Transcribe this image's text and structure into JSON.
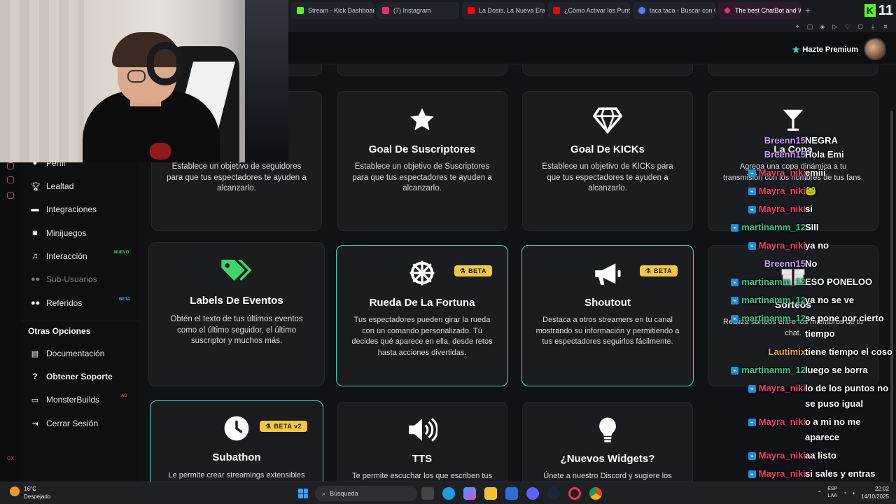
{
  "browser": {
    "tabs": [
      {
        "label": "Stream - Kick Dashboard",
        "color": "#53fc18"
      },
      {
        "label": "(7) Instagram",
        "color": "#e1306c"
      },
      {
        "label": "La Dosis, La Nueva Era",
        "color": "#ff0000"
      },
      {
        "label": "¿Cómo Activar los Puntos",
        "color": "#ff0000"
      },
      {
        "label": "taca taca - Buscar con Google",
        "color": "#4285f4"
      },
      {
        "label": "The best ChatBot and Widgets",
        "color": "#d9366b"
      }
    ],
    "new_tab": "+",
    "brand_number": "11"
  },
  "header": {
    "premium_label": "Hazte Premium"
  },
  "sidebar": {
    "items": [
      {
        "label": "Perfil",
        "icon": "user-icon"
      },
      {
        "label": "Lealtad",
        "icon": "trophy-icon"
      },
      {
        "label": "Integraciones",
        "icon": "screen-icon"
      },
      {
        "label": "Minijuegos",
        "icon": "gamepad-icon"
      },
      {
        "label": "Interacción",
        "icon": "music-icon",
        "badge": "NUEVO"
      },
      {
        "label": "Sub-Usuarios",
        "icon": "users-icon"
      },
      {
        "label": "Referidos",
        "icon": "users-icon",
        "badge": "BETA"
      }
    ],
    "section_title": "Otras Opciones",
    "other_items": [
      {
        "label": "Documentación",
        "icon": "document-icon"
      },
      {
        "label": "Obtener Soporte",
        "icon": "help-icon"
      },
      {
        "label": "MonsterBuilds",
        "icon": "laptop-icon",
        "badge": "AD"
      },
      {
        "label": "Cerrar Sesión",
        "icon": "logout-icon"
      }
    ],
    "footer": "GX"
  },
  "cards": [
    {
      "title": "",
      "desc": "Establece un objetivo de seguidores para que tus espectadores te ayuden a alcanzarlo.",
      "icon": "users-icon"
    },
    {
      "title": "Goal De Suscriptores",
      "desc": "Establece un objetivo de Suscriptores para que tus espectadores te ayuden a alcanzarlo.",
      "icon": "star-icon"
    },
    {
      "title": "Goal De KICKs",
      "desc": "Establece un objetivo de KICKs para que tus espectadores te ayuden a alcanzarlo.",
      "icon": "diamond-icon"
    },
    {
      "title": "La Copa",
      "desc": "Agrega una copa dinámica a tu transmisión con los nombres de tus fans.",
      "icon": "cocktail-icon"
    },
    {
      "title": "Labels De Eventos",
      "desc": "Obtén el texto de tus últimos eventos como el último seguidor, el último suscriptor y muchos más.",
      "icon": "tags-icon"
    },
    {
      "title": "Rueda De La Fortuna",
      "desc": "Tus espectadores pueden girar la rueda con un comando personalizado. Tú decides qué aparece en ella, desde retos hasta acciones divertidas.",
      "icon": "wheel-icon",
      "badge": "BETA"
    },
    {
      "title": "Shoutout",
      "desc": "Destaca a otros streamers en tu canal mostrando su información y permitiendo a tus espectadores seguirlos fácilmente.",
      "icon": "megaphone-icon",
      "badge": "BETA"
    },
    {
      "title": "Sorteos",
      "desc": "Realiza sorteos entre los miembros de tu chat.",
      "icon": "gift-icon"
    },
    {
      "title": "Subathon",
      "desc": "Le permite crear streamings extensibles",
      "icon": "clock-icon",
      "badge": "BETA v2"
    },
    {
      "title": "TTS",
      "desc": "Te permite escuchar los que escriben tus",
      "icon": "speaker-icon"
    },
    {
      "title": "¿Nuevos Widgets?",
      "desc": "Únete a nuestro Discord y sugiere los",
      "icon": "lightbulb-icon"
    }
  ],
  "chat": [
    {
      "user": "Breenn15",
      "text": "NEGRA",
      "color": "#c89bff",
      "tw": false
    },
    {
      "user": "Breenn15",
      "text": "Hola Emi",
      "color": "#c89bff",
      "tw": false
    },
    {
      "user": "Mayra_niki",
      "text": "emiii",
      "color": "#ff3b6b",
      "tw": true
    },
    {
      "user": "Mayra_niki",
      "text": "🐸",
      "color": "#ff3b6b",
      "tw": true
    },
    {
      "user": "Mayra_niki",
      "text": "si",
      "color": "#ff3b6b",
      "tw": true
    },
    {
      "user": "martinamm_12",
      "text": "SIII",
      "color": "#2ecf8a",
      "tw": true
    },
    {
      "user": "Mayra_niki",
      "text": "ya no",
      "color": "#ff3b6b",
      "tw": true
    },
    {
      "user": "Breenn15",
      "text": "No",
      "color": "#c89bff",
      "tw": false
    },
    {
      "user": "martinamm_12",
      "text": "ESO PONELOO",
      "color": "#2ecf8a",
      "tw": true
    },
    {
      "user": "martinamm_12",
      "text": "ya no se ve",
      "color": "#2ecf8a",
      "tw": true
    },
    {
      "user": "martinamm_12",
      "text": "se pone por cierto tiempo",
      "color": "#2ecf8a",
      "tw": true
    },
    {
      "user": "Lautimix",
      "text": "tiene tiempo el coso",
      "color": "#f2a13b",
      "tw": false
    },
    {
      "user": "martinamm_12",
      "text": "luego se borra",
      "color": "#2ecf8a",
      "tw": true
    },
    {
      "user": "Mayra_niki",
      "text": "lo de los puntos no se puso igual",
      "color": "#ff3b6b",
      "tw": true
    },
    {
      "user": "Mayra_niki",
      "text": "o a mi no me aparece",
      "color": "#ff3b6b",
      "tw": true
    },
    {
      "user": "Mayra_niki",
      "text": "aa listo",
      "color": "#ff3b6b",
      "tw": true
    },
    {
      "user": "Mayra_niki",
      "text": "si sales y entras aparece",
      "color": "#ff3b6b",
      "tw": true
    }
  ],
  "taskbar": {
    "temp": "16°C",
    "weather": "Despejado",
    "search_placeholder": "Búsqueda",
    "lang": "ESP",
    "lang_region": "LAA",
    "time": "22:02",
    "date": "14/10/2025"
  },
  "colors": {
    "accent": "#43d3c0",
    "beta_badge": "#f2c744",
    "kick_green": "#53fc18"
  }
}
